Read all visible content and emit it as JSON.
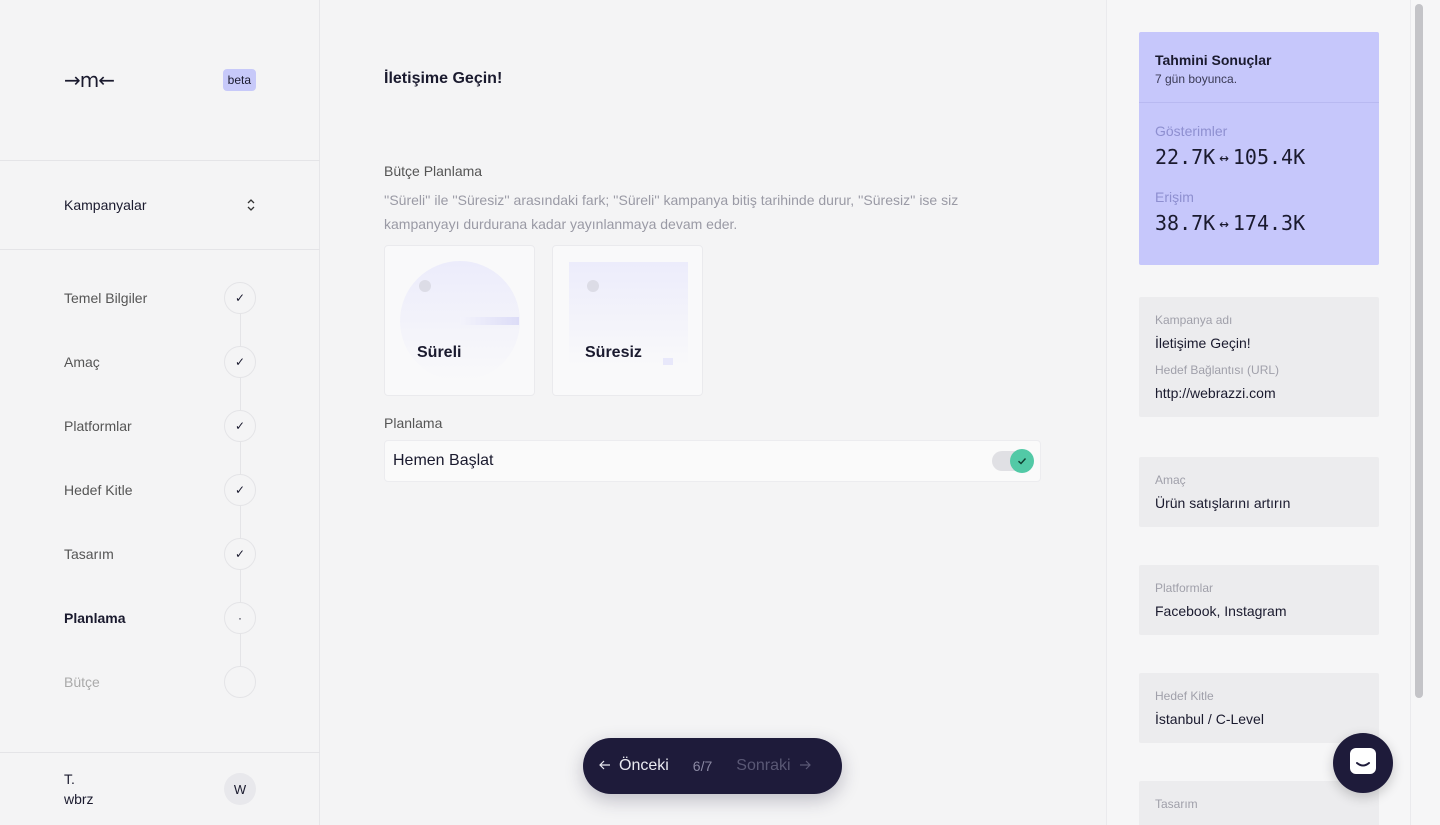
{
  "sidebar": {
    "logo": "→m←",
    "badge": "beta",
    "campaign_select": "Kampanyalar",
    "steps": [
      {
        "label": "Temel Bilgiler",
        "state": "done",
        "mark": "✓"
      },
      {
        "label": "Amaç",
        "state": "done",
        "mark": "✓"
      },
      {
        "label": "Platformlar",
        "state": "done",
        "mark": "✓"
      },
      {
        "label": "Hedef Kitle",
        "state": "done",
        "mark": "✓"
      },
      {
        "label": "Tasarım",
        "state": "done",
        "mark": "✓"
      },
      {
        "label": "Planlama",
        "state": "active",
        "mark": "·"
      },
      {
        "label": "Bütçe",
        "state": "pending",
        "mark": ""
      }
    ],
    "user": {
      "line1": "T.",
      "line2": "wbrz",
      "avatar": "W"
    }
  },
  "main": {
    "title": "İletişime Geçin!",
    "budget_label": "Bütçe Planlama",
    "budget_desc": "''Süreli'' ile ''Süresiz'' arasındaki fark; ''Süreli'' kampanya bitiş tarihinde durur, ''Süresiz'' ise siz kampanyayı durdurana kadar yayınlanmaya devam eder.",
    "options": [
      {
        "label": "Süreli"
      },
      {
        "label": "Süresiz"
      }
    ],
    "schedule_label": "Planlama",
    "schedule_value": "Hemen Başlat",
    "schedule_toggle_on": true
  },
  "pager": {
    "prev": "Önceki",
    "count": "6/7",
    "next": "Sonraki"
  },
  "estimate": {
    "title": "Tahmini Sonuçlar",
    "subtitle": "7 gün boyunca.",
    "metrics": [
      {
        "label": "Gösterimler",
        "min": "22.7K",
        "max": "105.4K"
      },
      {
        "label": "Erişim",
        "min": "38.7K",
        "max": "174.3K"
      }
    ]
  },
  "summary": {
    "campaign": {
      "name_label": "Kampanya adı",
      "name": "İletişime Geçin!",
      "url_label": "Hedef Bağlantısı (URL)",
      "url": "http://webrazzi.com"
    },
    "goal": {
      "label": "Amaç",
      "value": "Ürün satışlarını artırın"
    },
    "platforms": {
      "label": "Platformlar",
      "value": "Facebook, Instagram"
    },
    "audience": {
      "label": "Hedef Kitle",
      "value": "İstanbul / C-Level"
    },
    "design": {
      "label": "Tasarım"
    }
  },
  "colors": {
    "accent": "#c6c7fb",
    "dark": "#1e1b3a",
    "toggle_on": "#52c9a6"
  }
}
